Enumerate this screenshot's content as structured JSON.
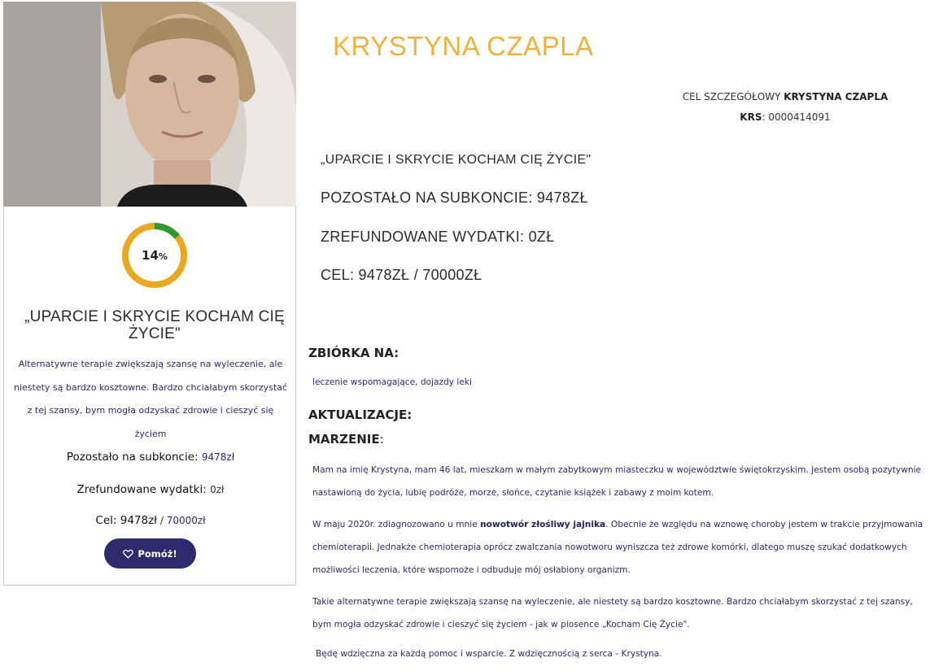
{
  "profile": {
    "name": "KRYSTYNA CZAPLA",
    "goal_prefix": "CEL SZCZEGÓŁOWY",
    "goal_name": "KRYSTYNA CZAPLA",
    "krs_label": "KRS",
    "krs_value": ": 0000414091"
  },
  "card": {
    "progress_percent": 14,
    "progress_number": "14",
    "progress_symbol": "%",
    "title_line1": "„UPARCIE I SKRYCIE KOCHAM CIĘ",
    "title_line2": "ŻYCIE\"",
    "description": "Alternatywne terapie zwiększają szansę na wyleczenie, ale niestety są bardzo kosztowne. Bardzo chciałabym skorzystać z tej szansy, bym mogła odzyskać zdrowie i cieszyć się życiem",
    "remaining_label": "Pozostało na subkoncie: ",
    "remaining_value": "9478zł",
    "refunded_label": "Zrefundowane wydatki: ",
    "refunded_value": "0zł",
    "goal_label": "Cel: 9478zł",
    "goal_value": " / 70000zł",
    "help_button": "Pomóż!"
  },
  "info": {
    "campaign_title": "„UPARCIE I SKRYCIE KOCHAM CIĘ ŻYCIE\"",
    "remaining": "POZOSTAŁO NA SUBKONCIE: 9478ZŁ",
    "refunded": "ZREFUNDOWANE WYDATKI: 0ZŁ",
    "goal": "CEL: 9478ZŁ / 70000ZŁ"
  },
  "sections": {
    "collection_head": "ZBIÓRKA NA:",
    "collection_text": "leczenie wspomagające, dojazdy leki",
    "updates_head": "AKTUALIZACJE:",
    "dream_head": "MARZENIE",
    "dream_colon": ":"
  },
  "story": {
    "p1": "Mam na imię Krystyna, mam 46 lat, mieszkam w małym zabytkowym miasteczku w województwie świętokrzyskim. Jestem osobą pozytywnie nastawioną do życia, lubię podróże, morze, słońce, czytanie książek i zabawy z moim kotem.",
    "p2_start": "W maju 2020r. zdiagnozowano u mnie ",
    "p2_bold": "nowotwór złośliwy jajnika",
    "p2_end": ". Obecnie że względu na wznowę choroby jestem w trakcie przyjmowania chemioterapii. Jednakże chemioterapia oprócz zwalczania nowotworu wyniszcza też zdrowe komórki, dlatego muszę szukać dodatkowych możliwości leczenia, które wspomoże i odbuduje mój osłabiony organizm.",
    "p3": "Takie alternatywne terapie zwiększają szansę na wyleczenie, ale niestety są bardzo kosztowne. Bardzo chciałabym skorzystać z tej szansy, bym mogła odzyskać zdrowie i cieszyć się życiem -  jak w piosence „Kocham Cię Życie\".",
    "p4": "Będę wdzięczna za każdą pomoc i wsparcie. Z wdzięcznością z serca - Krystyna."
  },
  "colors": {
    "accent": "#f0b23d",
    "progress_track": "#e8a820",
    "progress_fill": "#2e9a2e",
    "navy": "#2e2a6b"
  }
}
